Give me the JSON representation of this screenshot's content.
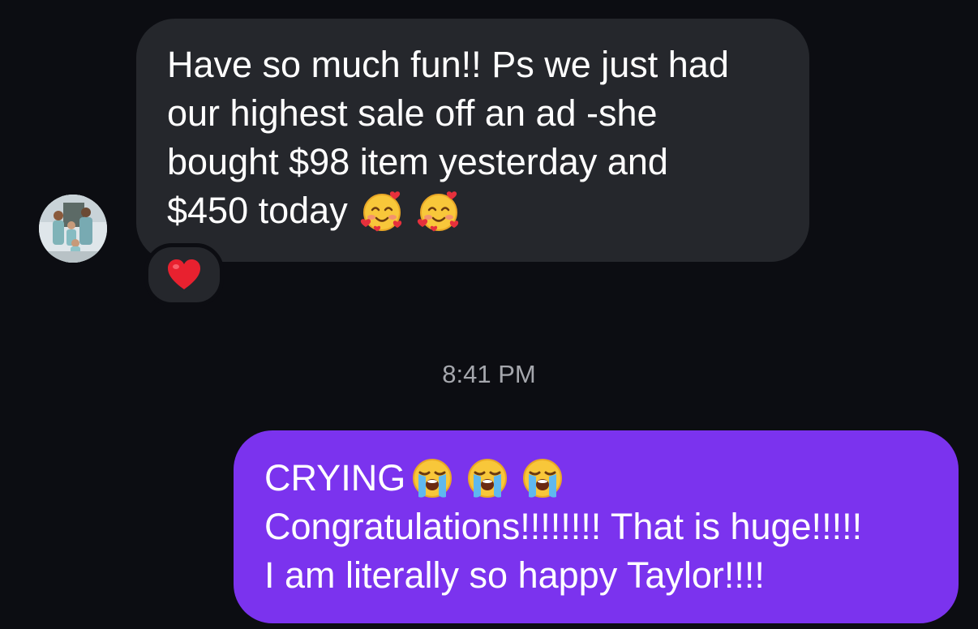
{
  "incoming": {
    "lines": [
      "Have so much fun!! Ps we just had",
      "our highest sale off an ad -she",
      "bought $98 item yesterday and",
      "$450 today"
    ],
    "trailing_emojis": [
      "smiling-face-with-hearts",
      "smiling-face-with-hearts"
    ],
    "reaction": "red-heart"
  },
  "timestamp": "8:41 PM",
  "outgoing": {
    "lines": [
      "CRYING",
      "Congratulations!!!!!!!! That is huge!!!!!",
      "I am literally so happy Taylor!!!!"
    ],
    "first_line_emojis": [
      "loudly-crying-face",
      "loudly-crying-face",
      "loudly-crying-face"
    ]
  },
  "colors": {
    "background": "#0c0d12",
    "incoming_bubble": "#25272c",
    "outgoing_bubble": "#7b33ee",
    "timestamp_text": "#a5a7ad",
    "message_text": "#ffffff"
  }
}
